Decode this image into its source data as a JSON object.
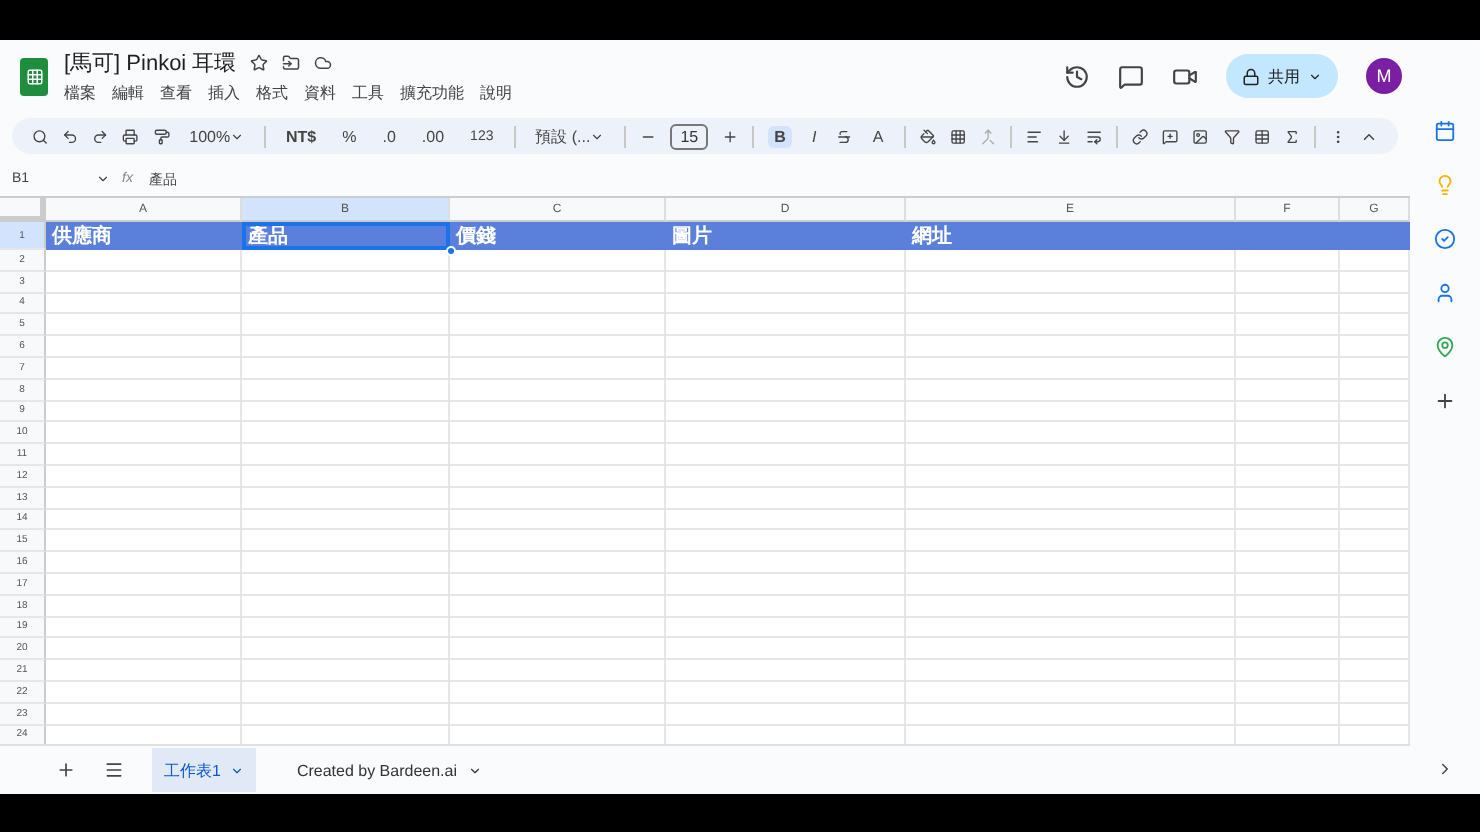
{
  "doc": {
    "title": "[馬可] Pinkoi 耳環",
    "menus": [
      "檔案",
      "編輯",
      "查看",
      "插入",
      "格式",
      "資料",
      "工具",
      "擴充功能",
      "說明"
    ],
    "share": "共用",
    "avatar": "M"
  },
  "toolbar": {
    "zoom": "100%",
    "currency": "NT$",
    "percent": "%",
    "decrease_decimal": ".0",
    "increase_decimal": ".00",
    "number_format": "123",
    "font": "預設 (...",
    "font_size": "15",
    "bold": {
      "label": "B",
      "on": true
    },
    "italic": {
      "label": "I",
      "on": false
    },
    "text_color": "A"
  },
  "formula_bar": {
    "cell": "B1",
    "fx": "fx",
    "value": "產品"
  },
  "columns": [
    {
      "label": "A",
      "selected": false
    },
    {
      "label": "B",
      "selected": true
    },
    {
      "label": "C",
      "selected": false
    },
    {
      "label": "D",
      "selected": false
    },
    {
      "label": "E",
      "selected": false
    },
    {
      "label": "F",
      "selected": false
    },
    {
      "label": "G",
      "selected": false
    }
  ],
  "header_row": {
    "number": "1",
    "cells": [
      "供應商",
      "產品",
      "價錢",
      "圖片",
      "網址"
    ]
  },
  "empty_rows": [
    "2",
    "3",
    "4",
    "5",
    "6",
    "7",
    "8",
    "9",
    "10",
    "11",
    "12",
    "13",
    "14",
    "15",
    "16",
    "17",
    "18",
    "19",
    "20",
    "21",
    "22",
    "23",
    "24"
  ],
  "sheet_tabs": [
    {
      "label": "工作表1",
      "selected": true
    },
    {
      "label": "Created by Bardeen.ai",
      "selected": false
    }
  ]
}
